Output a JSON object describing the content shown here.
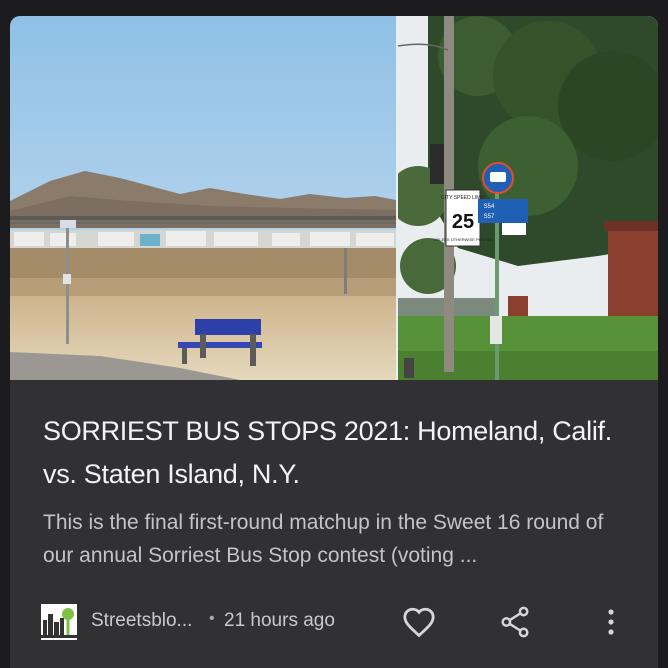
{
  "article": {
    "headline": "SORRIEST BUS STOPS 2021: Homeland, Calif. vs. Staten Island, N.Y.",
    "snippet": "This is the final first-round matchup in the Sweet 16 round of our annual Sorriest Bus Stop contest (voting ...",
    "source": "Streetsblo...",
    "separator": "•",
    "timestamp": "21 hours ago"
  },
  "photo_right_sign": {
    "speed_top": "CITY SPEED LIMIT",
    "speed_value": "25",
    "speed_bottom": "UNLESS OTHERWISE POSTED",
    "route_1": "S54",
    "route_2": "S57"
  },
  "actions": {
    "like_icon": "heart-outline-icon",
    "share_icon": "share-icon",
    "more_icon": "more-vertical-icon"
  },
  "colors": {
    "background": "#1c1c1e",
    "card": "#313134",
    "headline_text": "#f3f3f3",
    "body_text": "#c4c4c6",
    "bus_sign_blue": "#1f5fb4",
    "bench_blue": "#2d3fa8"
  }
}
